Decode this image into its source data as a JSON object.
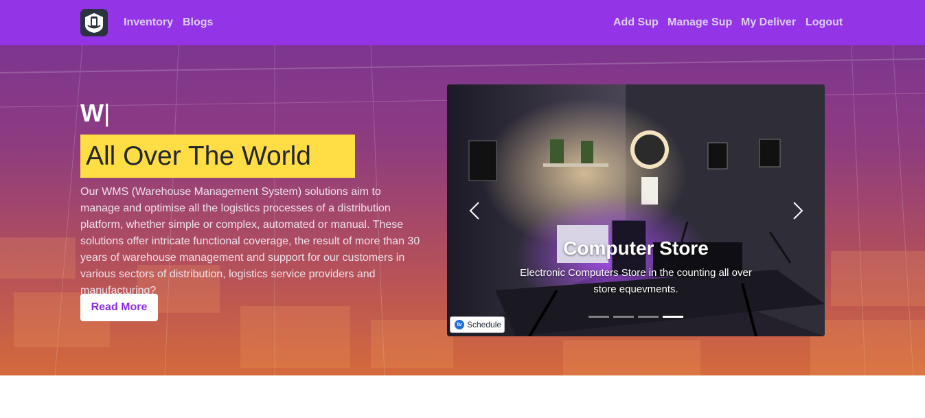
{
  "navbar": {
    "logo_icon": "warehouse-phone-logo-icon",
    "left_links": [
      "Inventory",
      "Blogs"
    ],
    "right_links": [
      "Add Sup",
      "Manage Sup",
      "My Deliver",
      "Logout"
    ],
    "background": "#9334e6"
  },
  "hero": {
    "typed_text": "W",
    "typed_cursor": "|",
    "headline": "All Over The World",
    "description": "Our WMS (Warehouse Management System) solutions aim to manage and optimise all the logistics processes of a distribution platform, whether simple or complex, automated or manual. These solutions offer intricate functional coverage, the result of more than 30 years of warehouse management and support for our customers in various sectors of distribution, logistics service providers and manufacturing?",
    "read_more_label": "Read More",
    "highlight_color": "#ffdd44"
  },
  "carousel": {
    "caption_title": "Computer Store",
    "caption_text": "Electronic Computers Store in the counting all over store equevments.",
    "prev_icon": "chevron-left-icon",
    "next_icon": "chevron-right-icon",
    "indicator_count": 4,
    "active_indicator": 4,
    "schedule_label": "Schedule",
    "schedule_badge": "tv"
  }
}
